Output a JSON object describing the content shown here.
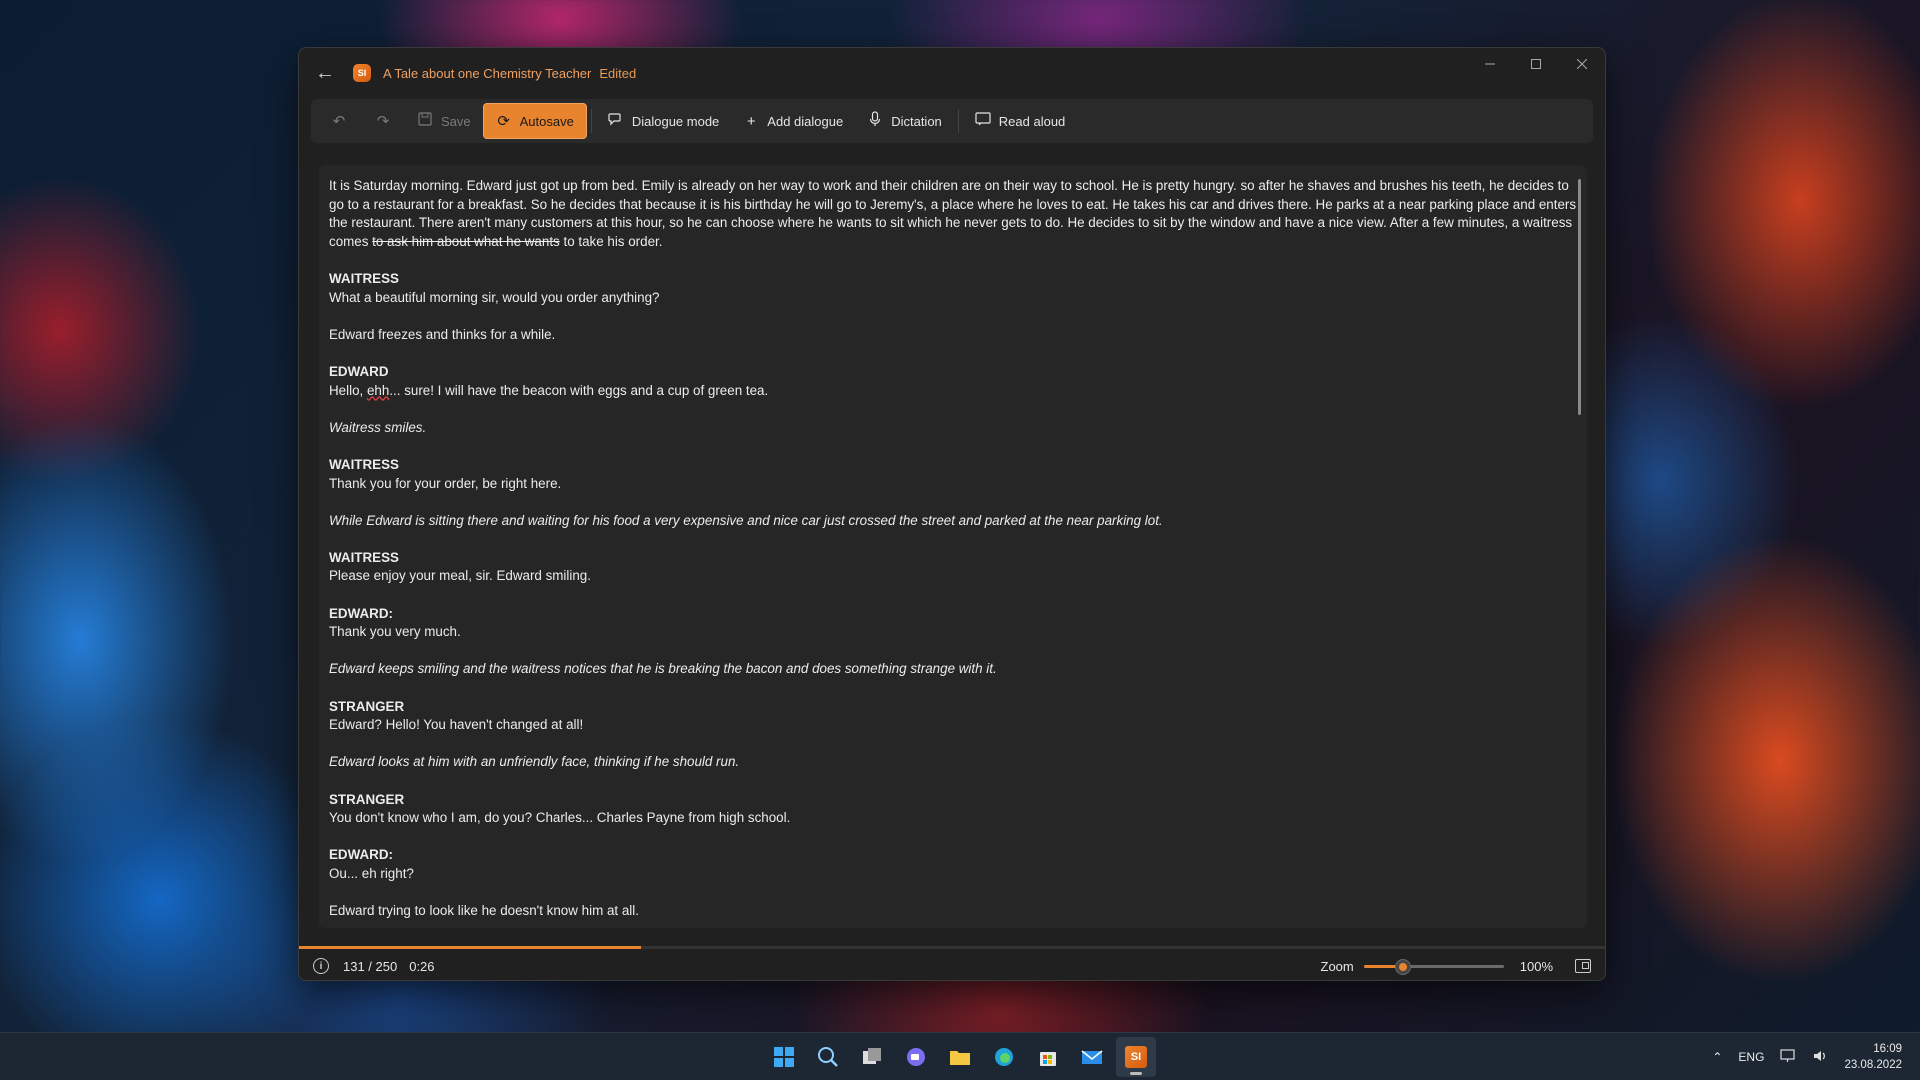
{
  "window": {
    "title": "A Tale about one Chemistry Teacher",
    "status": "Edited",
    "app_icon_text": "SI"
  },
  "toolbar": {
    "undo_icon": "undo-icon",
    "redo_icon": "redo-icon",
    "save_label": "Save",
    "autosave_label": "Autosave",
    "dialogue_mode_label": "Dialogue mode",
    "add_dialogue_label": "Add dialogue",
    "dictation_label": "Dictation",
    "read_aloud_label": "Read aloud"
  },
  "editor": {
    "intro_text": "It is Saturday morning. Edward just got up from bed. Emily is already on her way to work and their children are on their way to school. He is pretty hungry. so after he shaves and brushes his teeth, he decides to go to a restaurant for a breakfast. So he decides that because it is his birthday he will go to Jeremy's, a place where he loves to eat. He takes his car and drives there. He parks at a near parking place and enters the restaurant. There aren't many customers at this hour, so he can choose where he wants to sit which he never gets to do. He decides to sit by the window and have a nice view. After a few minutes, a waitress comes ",
    "intro_struck": "to ask him about what he wants",
    "intro_end": " to take his order.",
    "d1_speaker": "WAITRESS",
    "d1_line": "What a beautiful morning sir, would you order anything?",
    "a1": "Edward freezes and thinks for a while.",
    "d2_speaker": "EDWARD",
    "d2_pre": "Hello, ",
    "d2_misspelled": "ehh",
    "d2_post": "... sure! I will have the beacon with eggs and a cup of green tea.",
    "a2": "Waitress smiles.",
    "d3_speaker": "WAITRESS",
    "d3_line": "Thank you for your order, be right here.",
    "a3": "While Edward is sitting there and waiting for his food a very expensive and nice car just crossed the street and parked at the near parking lot.",
    "d4_speaker": "WAITRESS",
    "d4_line": "Please enjoy your meal, sir. Edward smiling.",
    "d5_speaker": "EDWARD:",
    "d5_line": "Thank you very much.",
    "a4": "Edward keeps smiling and the waitress notices that he is breaking the bacon and does something strange with it.",
    "d6_speaker": "STRANGER",
    "d6_line": "Edward? Hello! You haven't changed at all!",
    "a5": "Edward looks at him with an unfriendly face, thinking if he should run.",
    "d7_speaker": "STRANGER",
    "d7_line": "You don't know who I am, do you? Charles... Charles Payne from high school.",
    "d8_speaker": "EDWARD:",
    "d8_line": "Ou... eh right?",
    "a6": "Edward trying to look like he doesn't know him at all."
  },
  "status": {
    "word_count": "131 / 250",
    "read_time": "0:26",
    "progress_fraction": 0.262,
    "zoom_label": "Zoom",
    "zoom_value": "100%",
    "zoom_fraction": 0.25
  },
  "taskbar": {
    "apps": [
      "windows-start-icon",
      "search-icon",
      "task-view-icon",
      "chat-icon",
      "file-explorer-icon",
      "edge-browser-icon",
      "store-icon",
      "mail-icon",
      "storyist-app-icon"
    ],
    "active_app_text": "SI",
    "language": "ENG",
    "time": "16:09",
    "date": "23.08.2022"
  },
  "colors": {
    "accent": "#e8842d",
    "window_bg": "#202020",
    "editor_bg": "#262626",
    "title_text": "#f0a060"
  }
}
